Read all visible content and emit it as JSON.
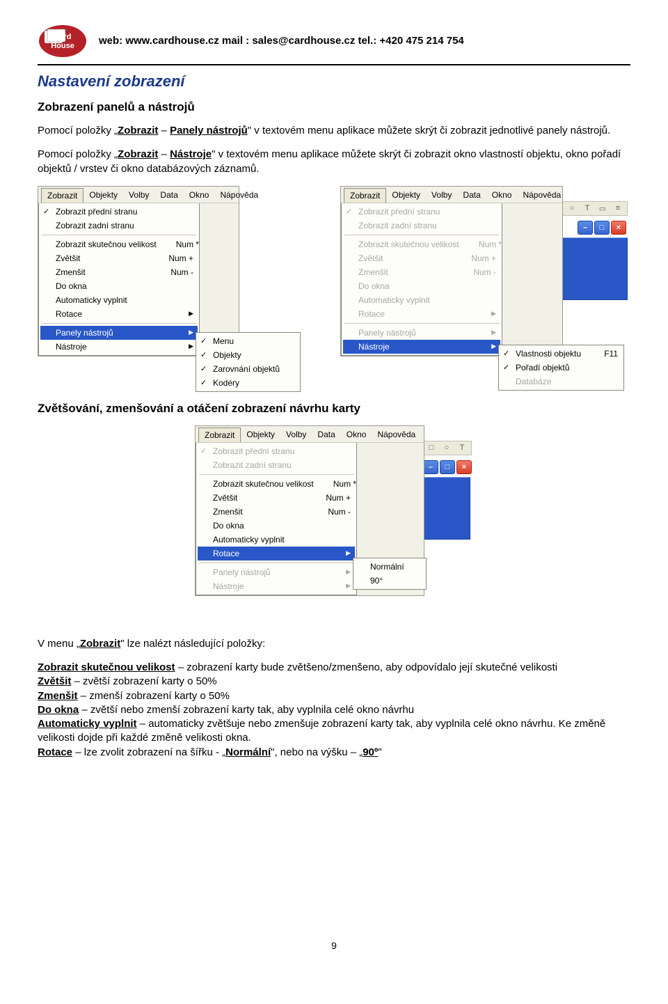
{
  "header": {
    "web_label": "web: ",
    "web_url": "www.cardhouse.cz",
    "mail_label": "  mail : ",
    "mail_addr": "sales@cardhouse.cz",
    "tel_label": "  tel.: ",
    "tel_num": "+420 475 214 754"
  },
  "section_title": "Nastavení zobrazení",
  "sub1_title": "Zobrazení panelů a nástrojů",
  "p1_a": "Pomocí položky „",
  "p1_b": "Zobrazit",
  "p1_c": " – ",
  "p1_d": "Panely nástrojů",
  "p1_e": "\" v textovém menu aplikace můžete skrýt či zobrazit jednotlivé panely nástrojů.",
  "p2_a": "Pomocí položky „",
  "p2_b": "Zobrazit",
  "p2_c": " – ",
  "p2_d": "Nástroje",
  "p2_e": "\" v textovém menu aplikace můžete skrýt či zobrazit okno vlastností objektu, okno pořadí objektů / vrstev či okno databázových záznamů.",
  "menubar": [
    "Zobrazit",
    "Objekty",
    "Volby",
    "Data",
    "Okno",
    "Nápověda"
  ],
  "drop": {
    "front": "Zobrazit přední stranu",
    "back": "Zobrazit zadní stranu",
    "actual": "Zobrazit skutečnou velikost",
    "actual_sc": "Num *",
    "zoomin": "Zvětšit",
    "zoomin_sc": "Num +",
    "zoomout": "Zmenšit",
    "zoomout_sc": "Num -",
    "fit": "Do okna",
    "auto": "Automaticky vyplnit",
    "rot": "Rotace",
    "panels": "Panely nástrojů",
    "tools": "Nástroje"
  },
  "sub_panels": {
    "menu": "Menu",
    "objects": "Objekty",
    "align": "Zarovnání objektů",
    "coders": "Kodéry"
  },
  "sub_tools": {
    "props": "Vlastnosti objektu",
    "props_sc": "F11",
    "order": "Pořadí objektů",
    "db": "Databáze"
  },
  "sub2_title": "Zvětšování, zmenšování a otáčení zobrazení návrhu karty",
  "sub_rot": {
    "normal": "Normální",
    "ninety": "90°"
  },
  "p3_a": "V menu „",
  "p3_b": "Zobrazit",
  "p3_c": "\" lze nalézt následující položky:",
  "def": {
    "d1a": "Zobrazit skutečnou velikost",
    "d1b": " – zobrazení karty bude zvětšeno/zmenšeno, aby odpovídalo její skutečné velikosti",
    "d2a": "Zvětšit",
    "d2b": " – zvětší zobrazení karty o 50%",
    "d3a": "Zmenšit",
    "d3b": " – zmenší zobrazení karty o 50%",
    "d4a": "Do okna",
    "d4b": " – zvětší nebo zmenší zobrazení karty tak, aby vyplnila celé okno návrhu",
    "d5a": "Automaticky vyplnit",
    "d5b": " – automaticky zvětšuje nebo zmenšuje zobrazení karty tak, aby vyplnila celé okno návrhu. Ke změně velikosti dojde při každé změně velikosti okna.",
    "d6a": "Rotace",
    "d6b": " – lze zvolit zobrazení na šířku - „",
    "d6c": "Normální",
    "d6d": "\", nebo na výšku – „",
    "d6e": "90º",
    "d6f": "\""
  },
  "page_number": "9"
}
